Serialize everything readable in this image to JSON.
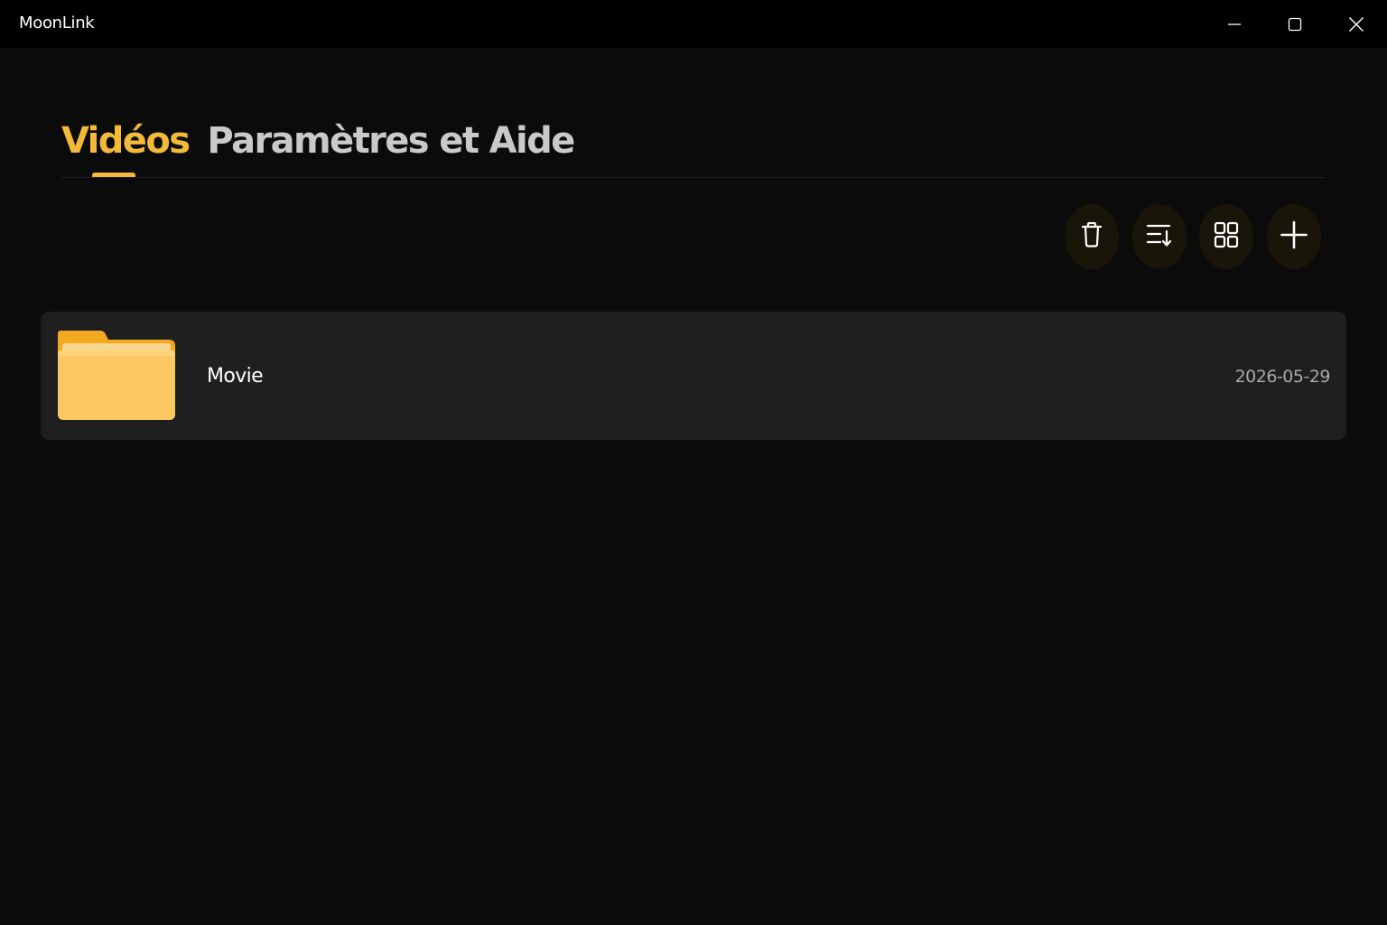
{
  "window": {
    "title": "MoonLink",
    "controls": {
      "minimize_icon": "minimize-icon",
      "maximize_icon": "maximize-icon",
      "close_icon": "close-icon"
    }
  },
  "tabs": [
    {
      "label": "Vidéos",
      "active": true
    },
    {
      "label": "Paramètres et Aide",
      "active": false
    }
  ],
  "toolbar": [
    {
      "name": "delete",
      "icon": "trash-icon"
    },
    {
      "name": "sort",
      "icon": "sort-icon"
    },
    {
      "name": "view",
      "icon": "grid-icon"
    },
    {
      "name": "add",
      "icon": "plus-icon"
    }
  ],
  "files": [
    {
      "name": "Movie",
      "date": "2026-05-29",
      "icon": "folder-icon"
    }
  ],
  "colors": {
    "accent": "#f3b93a",
    "background": "#0b0b0b",
    "titlebar": "#000000",
    "row": "#1f1f1f",
    "button": "#1a1509"
  }
}
